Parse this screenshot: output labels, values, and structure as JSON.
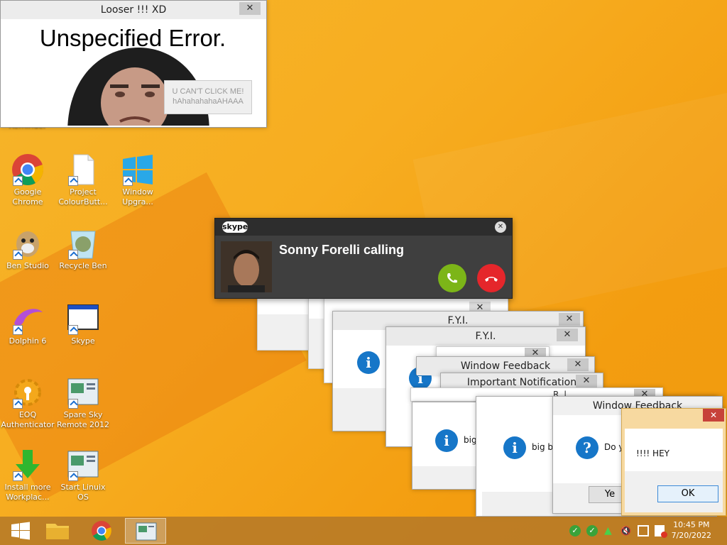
{
  "prank_window": {
    "title": "Looser !!! XD",
    "close": "✕",
    "error_text": "Unspecified Error.",
    "button_line1": "U CAN'T CLICK ME!",
    "button_line2": "hAhahahahaAHAAA"
  },
  "desktop": {
    "partial_label": "Reminder",
    "icons": [
      {
        "label": "Google Chrome"
      },
      {
        "label": "Project ColourButt..."
      },
      {
        "label": "Window Upgra..."
      },
      {
        "label": "Ben Studio"
      },
      {
        "label": "Recycle Ben"
      },
      {
        "label": "Dolphin 6"
      },
      {
        "label": "Skype"
      },
      {
        "label": "EOQ Authenticator"
      },
      {
        "label": "Spare Sky Remote 2012"
      },
      {
        "label": "Install more Workplac..."
      },
      {
        "label": "Start Linuix OS"
      }
    ]
  },
  "skype_call": {
    "logo": "skype",
    "caller": "Sonny Forelli calling",
    "close": "✕"
  },
  "dialogs": {
    "fyi1_title": "F.Y.I.",
    "fyi2_title": "F.Y.I.",
    "feedback_title": "Window Feedback",
    "important_title": "Important Notification",
    "feedback2_title": "Window Feedback",
    "partial_title": "R..l",
    "big_text1": "big",
    "big_text2": "big bo",
    "do_text": "Do y",
    "yes_btn": "Ye",
    "close": "✕"
  },
  "hey_dialog": {
    "message": "!!!! HEY",
    "ok": "OK",
    "close": "✕"
  },
  "taskbar": {
    "time": "10:45 PM",
    "date": "7/20/2022"
  },
  "colors": {
    "wallpaper": "#f7ad20",
    "skype_bg": "#3f3f3f",
    "accept_green": "#7cb518",
    "decline_red": "#e5262b",
    "info_blue": "#1676c8"
  }
}
